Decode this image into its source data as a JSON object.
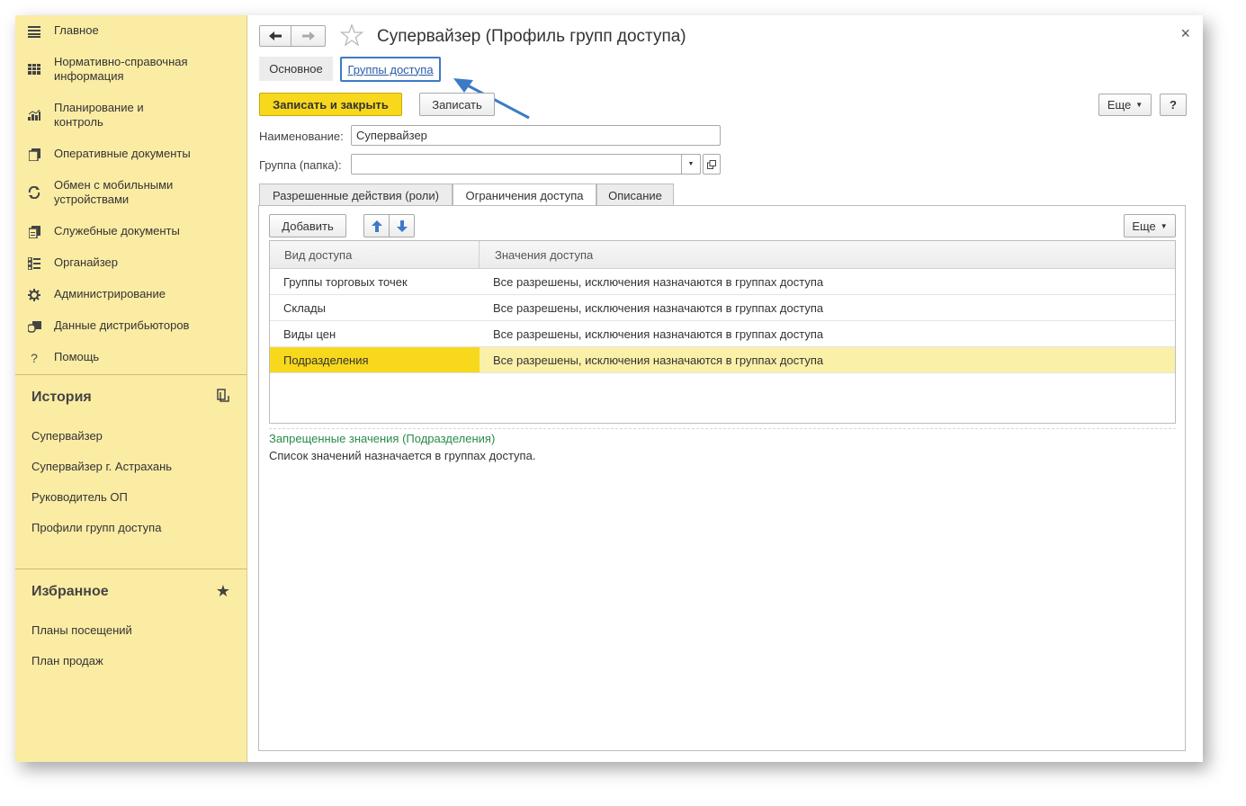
{
  "sidebar": {
    "nav": [
      {
        "label": "Главное",
        "icon": "menu-icon"
      },
      {
        "label": "Нормативно-справочная информация",
        "icon": "reference-grid-icon"
      },
      {
        "label": "Планирование и контроль",
        "icon": "chart-icon"
      },
      {
        "label": "Оперативные документы",
        "icon": "documents-icon"
      },
      {
        "label": "Обмен с мобильными устройствами",
        "icon": "sync-icon"
      },
      {
        "label": "Служебные документы",
        "icon": "service-documents-icon"
      },
      {
        "label": "Органайзер",
        "icon": "organizer-icon"
      },
      {
        "label": "Администрирование",
        "icon": "gear-icon"
      },
      {
        "label": "Данные дистрибьюторов",
        "icon": "distributors-icon"
      },
      {
        "label": "Помощь",
        "icon": "help-icon"
      }
    ],
    "history": {
      "title": "История",
      "items": [
        "Супервайзер",
        "Супервайзер г. Астрахань",
        "Руководитель ОП",
        "Профили групп доступа"
      ]
    },
    "favorites": {
      "title": "Избранное",
      "items": [
        "Планы посещений",
        "План продаж"
      ]
    }
  },
  "header": {
    "back": "🡐",
    "forward": "🡒",
    "title": "Супервайзер (Профиль групп доступа)",
    "close": "×"
  },
  "form_tabs": {
    "main": "Основное",
    "groups": "Группы доступа"
  },
  "toolbar": {
    "save_close": "Записать и закрыть",
    "save": "Записать",
    "more": "Еще",
    "help": "?"
  },
  "fields": {
    "name_label": "Наименование:",
    "name_value": "Супервайзер",
    "group_label": "Группа (папка):",
    "group_value": ""
  },
  "tabs": [
    "Разрешенные действия (роли)",
    "Ограничения доступа",
    "Описание"
  ],
  "panel": {
    "add": "Добавить",
    "more": "Еще",
    "columns": [
      "Вид доступа",
      "Значения доступа"
    ],
    "rows": [
      {
        "kind": "Группы торговых точек",
        "value": "Все разрешены, исключения назначаются в группах доступа"
      },
      {
        "kind": "Склады",
        "value": "Все разрешены, исключения назначаются в группах доступа"
      },
      {
        "kind": "Виды цен",
        "value": "Все разрешены, исключения назначаются в группах доступа"
      },
      {
        "kind": "Подразделения",
        "value": "Все разрешены, исключения назначаются в группах доступа"
      }
    ],
    "forbidden_title": "Запрещенные значения (Подразделения)",
    "forbidden_text": "Список значений назначается в группах доступа."
  },
  "colors": {
    "sidebar_bg": "#fbeca4",
    "accent_yellow": "#f8d81c",
    "link": "#2a5ca8",
    "annotation_arrow": "#3b7bc6",
    "green_title": "#2a8a4a"
  }
}
